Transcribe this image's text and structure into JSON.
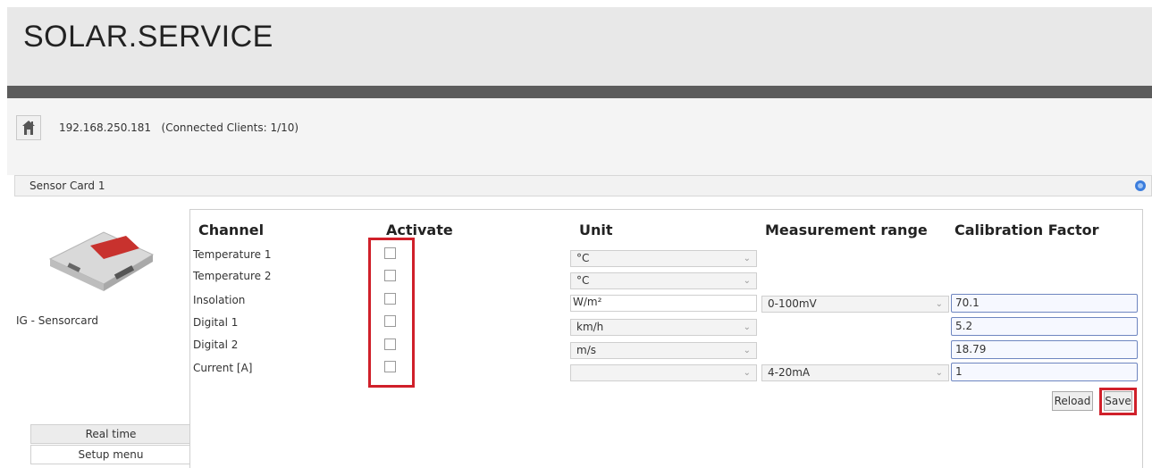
{
  "app": {
    "title": "SOLAR.SERVICE"
  },
  "connection": {
    "ip": "192.168.250.181",
    "clients": "(Connected Clients: 1/10)"
  },
  "panel": {
    "title": "Sensor Card 1"
  },
  "device": {
    "name": "IG - Sensorcard"
  },
  "nav": {
    "realtime": "Real time",
    "setup": "Setup menu"
  },
  "table": {
    "headers": {
      "channel": "Channel",
      "activate": "Activate",
      "unit": "Unit",
      "range": "Measurement range",
      "calibration": "Calibration Factor"
    },
    "rows": [
      {
        "channel": "Temperature 1",
        "active": false,
        "unit": "°C"
      },
      {
        "channel": "Temperature 2",
        "active": false,
        "unit": "°C"
      },
      {
        "channel": "Insolation",
        "active": false,
        "unit": "W/m²",
        "range": "0-100mV",
        "calibration": "70.1"
      },
      {
        "channel": "Digital 1",
        "active": false,
        "unit": "km/h",
        "calibration": "5.2"
      },
      {
        "channel": "Digital 2",
        "active": false,
        "unit": "m/s",
        "calibration": "18.79"
      },
      {
        "channel": "Current [A]",
        "active": false,
        "unit": "",
        "range": "4-20mA",
        "calibration": "1"
      }
    ]
  },
  "buttons": {
    "reload": "Reload",
    "save": "Save"
  },
  "icons": {
    "home": "home-icon",
    "panel": "collapse-icon",
    "dropdown": "chevron-down-icon"
  },
  "colors": {
    "highlight": "#d0202a",
    "header_bar": "#5c5c5c"
  }
}
